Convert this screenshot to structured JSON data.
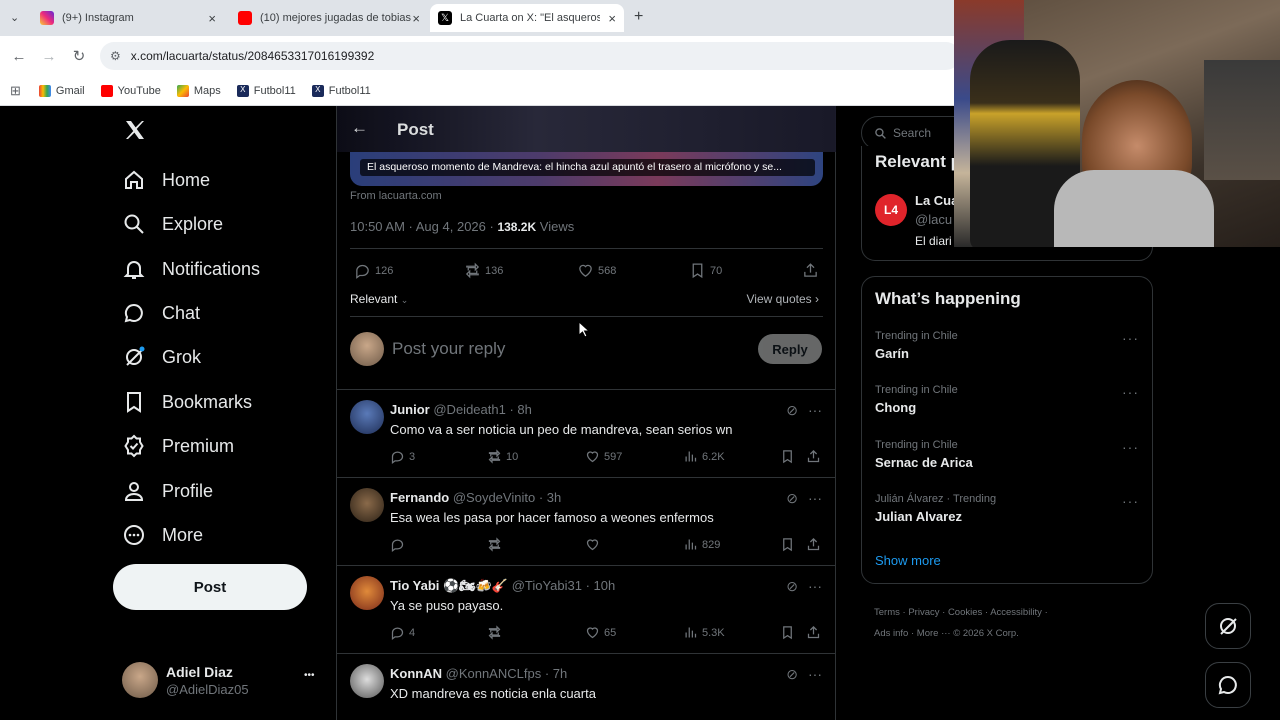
{
  "browser": {
    "tabs": [
      {
        "title": "(9+) Instagram",
        "active": false
      },
      {
        "title": "(10) mejores jugadas de tobias",
        "active": false
      },
      {
        "title": "La Cuarta on X: \"El asqueroso m",
        "active": true
      }
    ],
    "new_tab": "+",
    "url": "x.com/lacuarta/status/2084653317016199392",
    "bookmarks": [
      "Gmail",
      "YouTube",
      "Maps",
      "Futbol11",
      "Futbol11"
    ]
  },
  "sidebar": {
    "items": [
      {
        "label": "Home"
      },
      {
        "label": "Explore"
      },
      {
        "label": "Notifications"
      },
      {
        "label": "Chat"
      },
      {
        "label": "Grok"
      },
      {
        "label": "Bookmarks"
      },
      {
        "label": "Premium"
      },
      {
        "label": "Profile"
      },
      {
        "label": "More"
      }
    ],
    "post_button": "Post",
    "account": {
      "name": "Adiel Diaz",
      "handle": "@AdielDiaz05",
      "more": "•••"
    }
  },
  "post": {
    "header_title": "Post",
    "card_title": "El asqueroso momento de Mandreva: el hincha azul apuntó el trasero al micrófono y se...",
    "source": "From lacuarta.com",
    "timestamp": "10:50 AM · Aug 4, 2026 ·",
    "views_count": "138.2K",
    "views_label": "Views",
    "stats": {
      "replies": "126",
      "reposts": "136",
      "likes": "568",
      "bookmarks": "70"
    },
    "sort_label": "Relevant",
    "view_quotes": "View quotes",
    "reply_placeholder": "Post your reply",
    "reply_button": "Reply"
  },
  "replies": [
    {
      "name": "Junior",
      "handle": "@Deideath1",
      "time": "· 8h",
      "text": "Como va a ser noticia un peo de mandreva, sean serios wn",
      "replies": "3",
      "reposts": "10",
      "likes": "597",
      "views": "6.2K"
    },
    {
      "name": "Fernando",
      "handle": "@SoydeVinito",
      "time": "· 3h",
      "text": "Esa wea les pasa por hacer famoso a weones enfermos",
      "replies": "",
      "reposts": "",
      "likes": "",
      "views": "829"
    },
    {
      "name": "Tio Yabi ⚽🏍🍻🎸",
      "handle": "@TioYabi31",
      "time": "· 10h",
      "text": "Ya se puso payaso.",
      "replies": "4",
      "reposts": "",
      "likes": "65",
      "views": "5.3K"
    },
    {
      "name": "KonnAN",
      "handle": "@KonnANCLfps",
      "time": "· 7h",
      "text": "XD mandreva es noticia enla cuarta",
      "replies": "",
      "reposts": "",
      "likes": "",
      "views": ""
    }
  ],
  "right": {
    "search_placeholder": "Search",
    "relevant_title": "Relevant p",
    "relevant_account": {
      "badge": "L4",
      "name": "La Cua",
      "handle": "@lacu",
      "bio": "El diari"
    },
    "happening_title": "What’s happening",
    "trends": [
      {
        "category": "Trending in Chile",
        "name": "Garín"
      },
      {
        "category": "Trending in Chile",
        "name": "Chong"
      },
      {
        "category": "Trending in Chile",
        "name": "Sernac de Arica"
      },
      {
        "category": "Julián Álvarez · Trending",
        "name": "Julian Alvarez"
      }
    ],
    "show_more": "Show more",
    "footer": [
      "Terms",
      "Privacy",
      "Cookies",
      "Accessibility",
      "Ads info",
      "More ···",
      "© 2026 X Corp."
    ]
  },
  "colors": {
    "accent": "#1d9bf0",
    "background": "#000000",
    "border": "#2f3336",
    "muted": "#71767b",
    "grok_dot": "#1d9bf0"
  }
}
